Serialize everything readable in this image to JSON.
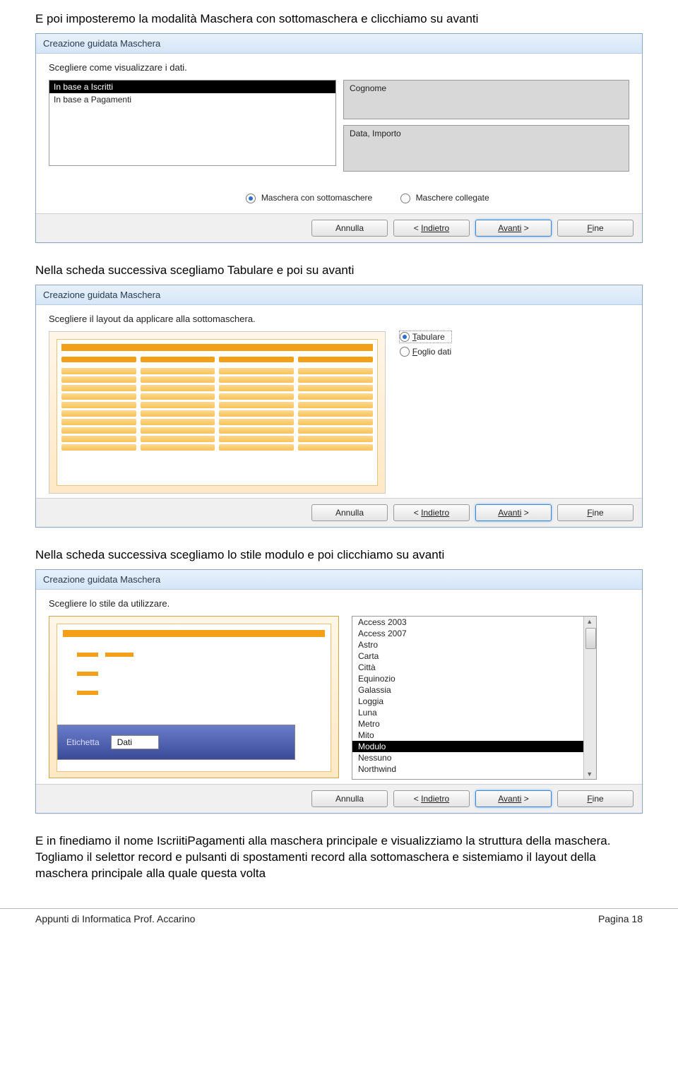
{
  "para1": "E poi imposteremo la modalità Maschera con sottomaschera e clicchiamo su avanti",
  "para2": "Nella scheda successiva scegliamo Tabulare e poi su avanti",
  "para3": "Nella scheda successiva scegliamo lo stile modulo e poi clicchiamo su avanti",
  "para4": "E in finediamo il nome IscriitiPagamenti alla maschera principale e visualizziamo la struttura della maschera. Togliamo il selettor record e pulsanti di spostamenti record  alla sottomaschera e sistemiamo il layout della maschera principale alla quale questa volta",
  "dlg1": {
    "title": "Creazione guidata Maschera",
    "prompt": "Scegliere come visualizzare i dati.",
    "leftItems": [
      "In base a Iscritti",
      "In base a Pagamenti"
    ],
    "rightTop": "Cognome",
    "rightBottom": "Data, Importo",
    "radio1": "Maschera con sottomaschere",
    "radio2": "Maschere collegate"
  },
  "dlg2": {
    "title": "Creazione guidata Maschera",
    "prompt": "Scegliere il layout da applicare alla sottomaschera.",
    "radio1": "Tabulare",
    "radio2": "Foglio dati"
  },
  "dlg3": {
    "title": "Creazione guidata Maschera",
    "prompt": "Scegliere lo stile da utilizzare.",
    "etichetta": "Etichetta",
    "dati": "Dati",
    "styles": [
      "Access 2003",
      "Access 2007",
      "Astro",
      "Carta",
      "Città",
      "Equinozio",
      "Galassia",
      "Loggia",
      "Luna",
      "Metro",
      "Mito",
      "Modulo",
      "Nessuno",
      "Northwind"
    ],
    "selected": "Modulo"
  },
  "buttons": {
    "annulla": "Annulla",
    "indietro_lt": "<",
    "indietro": "Indietro",
    "avanti": "Avanti",
    "avanti_gt": ">",
    "fine": "Fine"
  },
  "footer_left": "Appunti di Informatica Prof. Accarino",
  "footer_right": "Pagina 18"
}
